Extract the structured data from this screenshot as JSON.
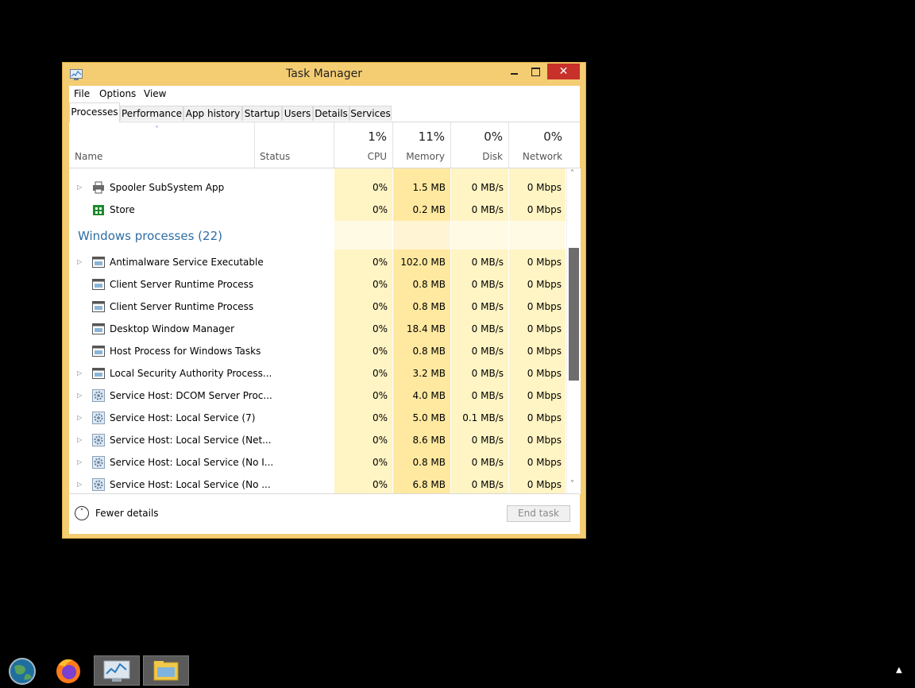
{
  "window": {
    "title": "Task Manager",
    "close_glyph": "✕"
  },
  "menu": [
    "File",
    "Options",
    "View"
  ],
  "tabs": [
    "Processes",
    "Performance",
    "App history",
    "Startup",
    "Users",
    "Details",
    "Services"
  ],
  "active_tab": "Processes",
  "header": {
    "sort_indicator": "˄",
    "name": "Name",
    "status": "Status",
    "columns": [
      {
        "pct": "1%",
        "label": "CPU"
      },
      {
        "pct": "11%",
        "label": "Memory"
      },
      {
        "pct": "0%",
        "label": "Disk"
      },
      {
        "pct": "0%",
        "label": "Network"
      }
    ]
  },
  "apps_rows": [
    {
      "name": "Spooler SubSystem App",
      "icon": "printer-icon",
      "expandable": true,
      "cpu": "0%",
      "memory": "1.5 MB",
      "disk": "0 MB/s",
      "network": "0 Mbps"
    },
    {
      "name": "Store",
      "icon": "store-icon",
      "expandable": false,
      "cpu": "0%",
      "memory": "0.2 MB",
      "disk": "0 MB/s",
      "network": "0 Mbps"
    }
  ],
  "group": {
    "title": "Windows processes (22)"
  },
  "windows_rows": [
    {
      "name": "Antimalware Service Executable",
      "icon": "window-icon",
      "expandable": true,
      "cpu": "0%",
      "memory": "102.0 MB",
      "disk": "0 MB/s",
      "network": "0 Mbps"
    },
    {
      "name": "Client Server Runtime Process",
      "icon": "window-icon",
      "expandable": false,
      "cpu": "0%",
      "memory": "0.8 MB",
      "disk": "0 MB/s",
      "network": "0 Mbps"
    },
    {
      "name": "Client Server Runtime Process",
      "icon": "window-icon",
      "expandable": false,
      "cpu": "0%",
      "memory": "0.8 MB",
      "disk": "0 MB/s",
      "network": "0 Mbps"
    },
    {
      "name": "Desktop Window Manager",
      "icon": "window-icon",
      "expandable": false,
      "cpu": "0%",
      "memory": "18.4 MB",
      "disk": "0 MB/s",
      "network": "0 Mbps"
    },
    {
      "name": "Host Process for Windows Tasks",
      "icon": "window-icon",
      "expandable": false,
      "cpu": "0%",
      "memory": "0.8 MB",
      "disk": "0 MB/s",
      "network": "0 Mbps"
    },
    {
      "name": "Local Security Authority Process...",
      "icon": "window-icon",
      "expandable": true,
      "cpu": "0%",
      "memory": "3.2 MB",
      "disk": "0 MB/s",
      "network": "0 Mbps"
    },
    {
      "name": "Service Host: DCOM Server Proc...",
      "icon": "gear-icon",
      "expandable": true,
      "cpu": "0%",
      "memory": "4.0 MB",
      "disk": "0 MB/s",
      "network": "0 Mbps"
    },
    {
      "name": "Service Host: Local Service (7)",
      "icon": "gear-icon",
      "expandable": true,
      "cpu": "0%",
      "memory": "5.0 MB",
      "disk": "0.1 MB/s",
      "network": "0 Mbps"
    },
    {
      "name": "Service Host: Local Service (Net...",
      "icon": "gear-icon",
      "expandable": true,
      "cpu": "0%",
      "memory": "8.6 MB",
      "disk": "0 MB/s",
      "network": "0 Mbps"
    },
    {
      "name": "Service Host: Local Service (No I...",
      "icon": "gear-icon",
      "expandable": true,
      "cpu": "0%",
      "memory": "0.8 MB",
      "disk": "0 MB/s",
      "network": "0 Mbps"
    },
    {
      "name": "Service Host: Local Service (No ...",
      "icon": "gear-icon",
      "expandable": true,
      "cpu": "0%",
      "memory": "6.8 MB",
      "disk": "0 MB/s",
      "network": "0 Mbps"
    }
  ],
  "footer": {
    "fewer_details": "Fewer details",
    "end_task": "End task"
  },
  "taskbar": [
    "globe-icon",
    "firefox-icon",
    "task-manager-icon",
    "file-explorer-icon"
  ],
  "colors": {
    "frame": "#f4cd73",
    "heat_light": "#fff4c4",
    "heat_dark": "#ffe9a0",
    "group_title": "#2e6da4",
    "close": "#c7312a"
  }
}
